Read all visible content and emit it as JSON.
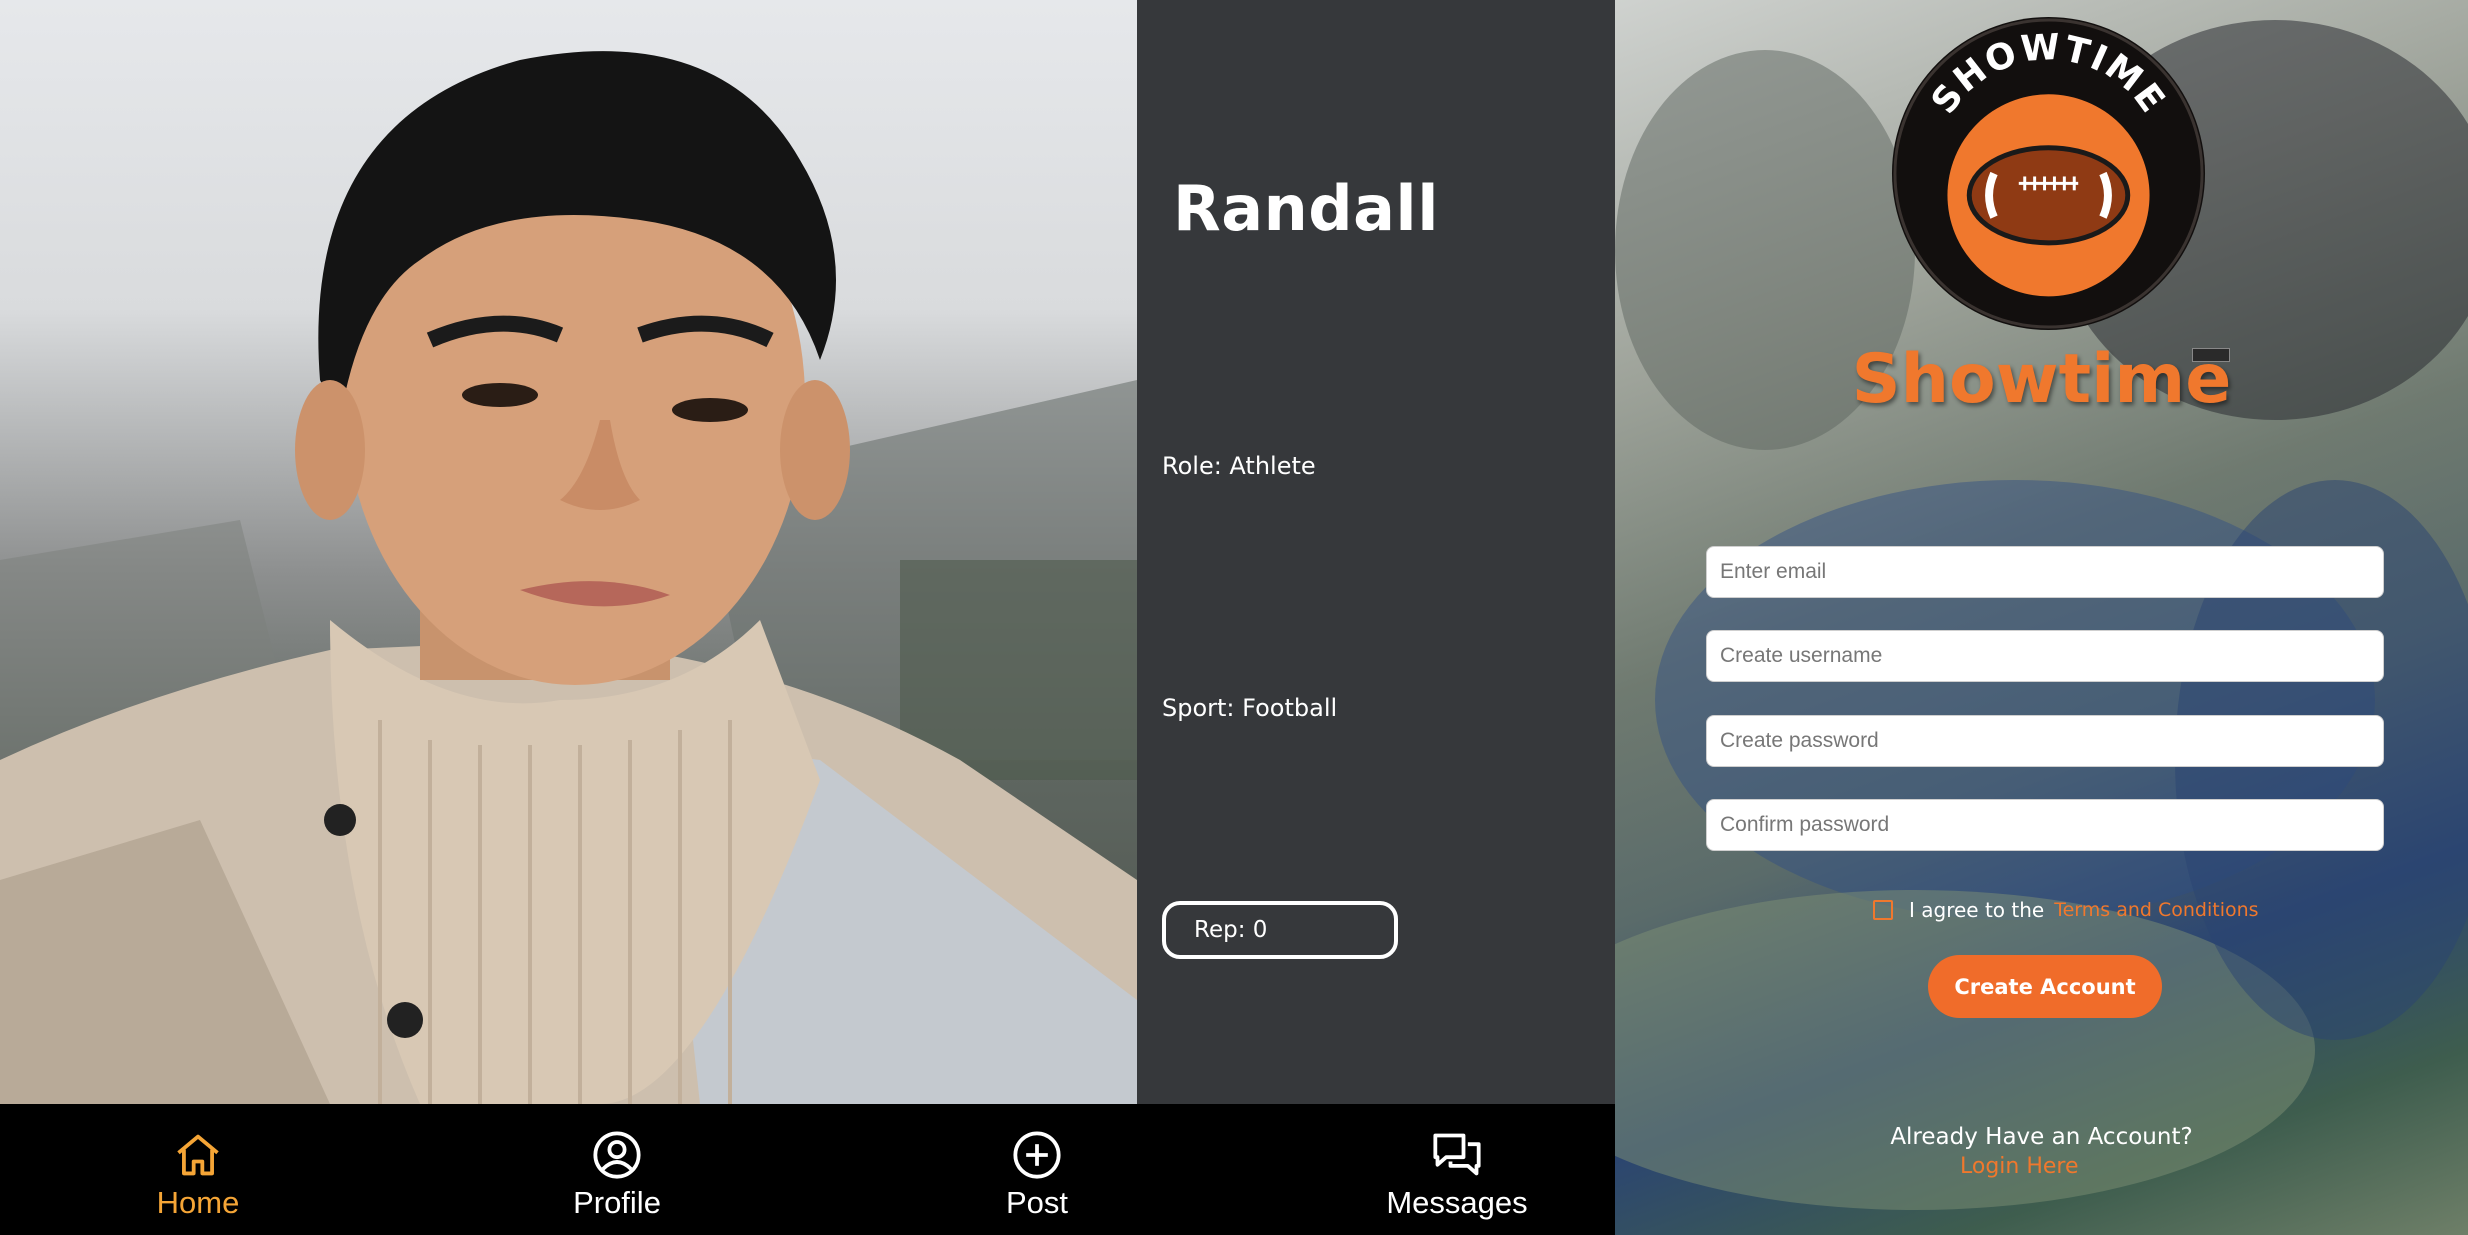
{
  "profile": {
    "name": "Randall",
    "role": "Role: Athlete",
    "sport": "Sport: Football",
    "rep": "Rep: 0",
    "photo_alt": "profile-photo"
  },
  "nav": {
    "items": [
      {
        "label": "Home",
        "icon": "home-icon",
        "active": true
      },
      {
        "label": "Profile",
        "icon": "user-circle-icon",
        "active": false
      },
      {
        "label": "Post",
        "icon": "plus-circle-icon",
        "active": false
      },
      {
        "label": "Messages",
        "icon": "chat-bubbles-icon",
        "active": false
      }
    ]
  },
  "signup": {
    "logo_text": "SHOWTIME",
    "brand": "Showtime",
    "email_placeholder": "Enter email",
    "username_placeholder": "Create username",
    "password_placeholder": "Create password",
    "confirm_placeholder": "Confirm password",
    "agree_text": "I agree to the",
    "terms_link": "Terms and Conditions",
    "create_button": "Create Account",
    "already_text": "Already Have an Account?",
    "login_link": "Login Here"
  },
  "colors": {
    "accent_orange": "#f0782d",
    "nav_active": "#f5a536",
    "info_bg": "#36383b"
  }
}
